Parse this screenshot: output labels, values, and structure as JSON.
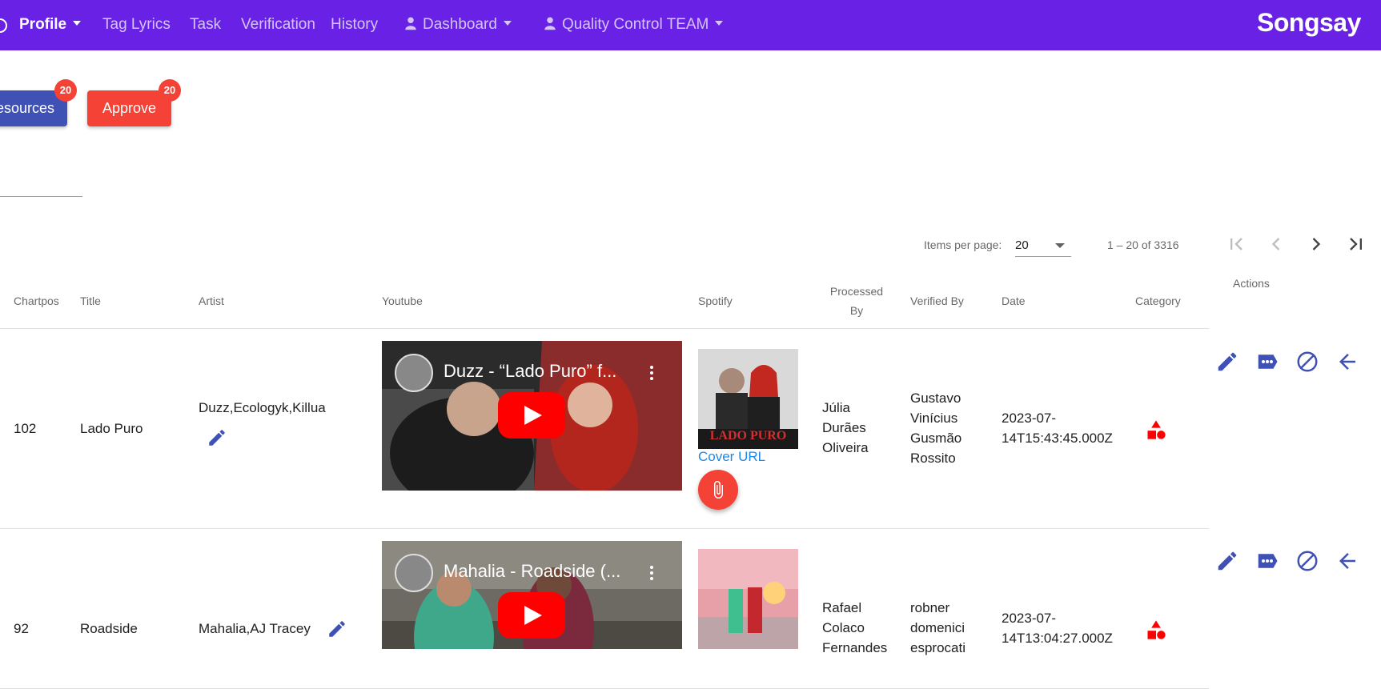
{
  "nav": {
    "profile": "Profile",
    "tag_lyrics": "Tag Lyrics",
    "task": "Task",
    "verification": "Verification",
    "history": "History",
    "dashboard": "Dashboard",
    "team": "Quality Control TEAM",
    "logo": "Songsay"
  },
  "actions": {
    "resources_label": "esources",
    "resources_badge": "20",
    "approve_label": "Approve",
    "approve_badge": "20"
  },
  "paginator": {
    "items_per_page_label": "Items per page:",
    "page_size": "20",
    "range": "1 – 20 of 3316"
  },
  "table": {
    "headers": {
      "chartpos": "Chartpos",
      "title": "Title",
      "artist": "Artist",
      "youtube": "Youtube",
      "spotify": "Spotify",
      "processed_by_1": "Processed",
      "processed_by_2": "By",
      "verified_by": "Verified By",
      "date": "Date",
      "category": "Category",
      "actions": "Actions"
    },
    "rows": [
      {
        "chartpos": "102",
        "title": "Lado Puro",
        "artist": "Duzz,Ecologyk,Killua",
        "video_title": "Duzz - “Lado Puro” f...",
        "cover_link": "Cover URL",
        "cover_text": "LADO PURO",
        "processed_by": [
          "Júlia",
          "Durães",
          "Oliveira"
        ],
        "verified_by": [
          "Gustavo",
          "Vinícius",
          "Gusmão",
          "Rossito"
        ],
        "date": [
          "2023-07-",
          "14T15:43:45.000Z"
        ]
      },
      {
        "chartpos": "92",
        "title": "Roadside",
        "artist": "Mahalia,AJ Tracey",
        "video_title": "Mahalia - Roadside (...",
        "processed_by": [
          "Rafael",
          "Colaco",
          "Fernandes"
        ],
        "verified_by": [
          "robner",
          "domenici",
          "esprocati"
        ],
        "date": [
          "2023-07-",
          "14T13:04:27.000Z"
        ]
      }
    ]
  },
  "colors": {
    "nav_bg": "#6a21e6",
    "primary": "#3f51b5",
    "warn": "#f44336",
    "link": "#1e88e5"
  }
}
